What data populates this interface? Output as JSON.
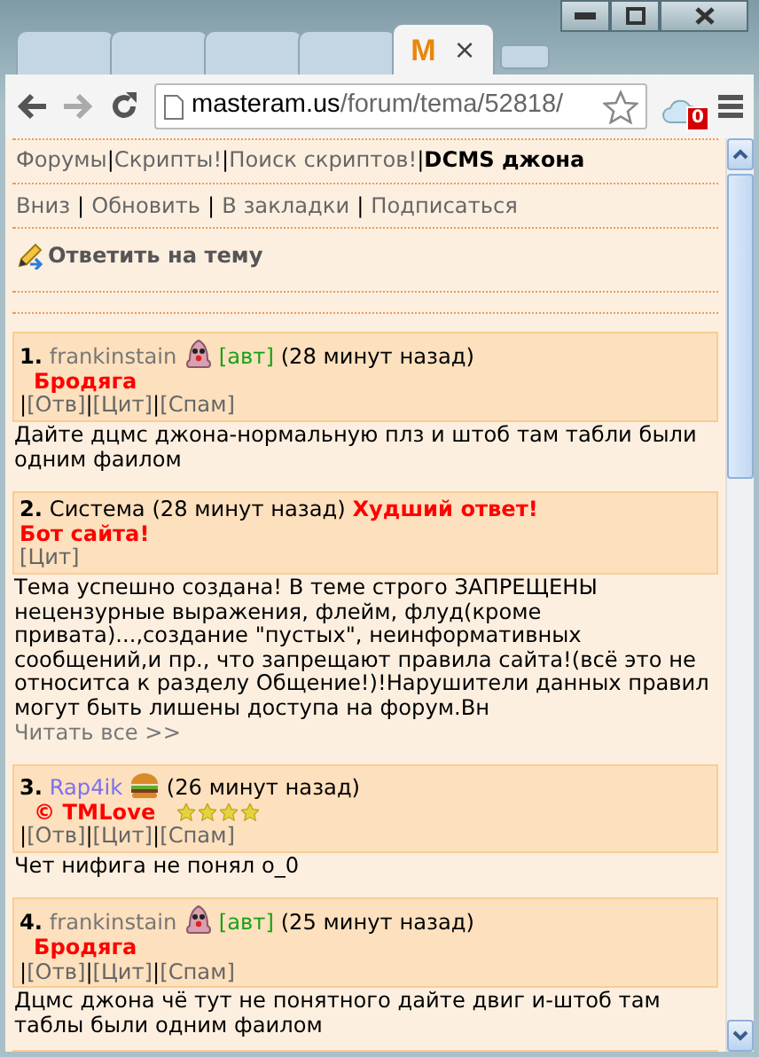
{
  "browser": {
    "tabs": [
      {
        "selected": false
      },
      {
        "selected": false
      },
      {
        "selected": false
      },
      {
        "selected": false
      },
      {
        "selected": true,
        "logo": "M",
        "close": "×"
      }
    ],
    "address": {
      "host": "masteram.us",
      "path": "/forum/tema/52818/"
    },
    "extension_badge": "0"
  },
  "page": {
    "separator": "|",
    "breadcrumbs": [
      {
        "label": "Форумы",
        "current": false
      },
      {
        "label": "Скрипты!",
        "current": false
      },
      {
        "label": "Поиск скриптов!",
        "current": false
      },
      {
        "label": "DCMS джона",
        "current": true
      }
    ],
    "actions": [
      "Вниз",
      "Обновить",
      "В закладки",
      "Подписаться"
    ],
    "reply_link": "Ответить на тему",
    "posts": [
      {
        "number": "1.",
        "author": "frankinstain",
        "color": "#777777",
        "kind": "blob",
        "tag": "[авт]",
        "time": "(28 минут назад)",
        "status": "Бродяга",
        "buttons": [
          "[Отв]",
          "[Цит]",
          "[Спам]"
        ],
        "leading_separator": true,
        "body": "Дайте дцмс джона-нормальную плз и штоб там табли были одним фаилом"
      },
      {
        "number": "2.",
        "author": "Система",
        "color": "#000000",
        "kind": "plain",
        "time": "(28 минут назад)",
        "verdict": "Худший ответ!",
        "status": "Бот сайта!",
        "buttons": [
          "[Цит]"
        ],
        "leading_separator": false,
        "body": "Тема успешно создана! В теме строго ЗАПРЕЩЕНЫ нецензурные выражения, флейм, флуд(кроме привата)...,создание \"пустых\", неинформативных сообщений,и пр., что запрещают правила сайта!(всё это не относитса к разделу Общение!)!Нарушители данных правил могут быть лишены доступа на форум.Вн",
        "more": "Читать все >>"
      },
      {
        "number": "3.",
        "author": "Rap4ik",
        "color": "#7b6ff0",
        "kind": "burger",
        "time": "(26 минут назад)",
        "status": "© TMLove",
        "stars": 4,
        "buttons": [
          "[Отв]",
          "[Цит]",
          "[Спам]"
        ],
        "leading_separator": true,
        "body": "Чет нифига не понял о_0"
      },
      {
        "number": "4.",
        "author": "frankinstain",
        "color": "#777777",
        "kind": "blob",
        "tag": "[авт]",
        "time": "(25 минут назад)",
        "status": "Бродяга",
        "buttons": [
          "[Отв]",
          "[Цит]",
          "[Спам]"
        ],
        "leading_separator": true,
        "body": "Дцмс джона чё тут не понятного дайте двиг и-штоб там таблы были одним фаилом"
      }
    ]
  }
}
